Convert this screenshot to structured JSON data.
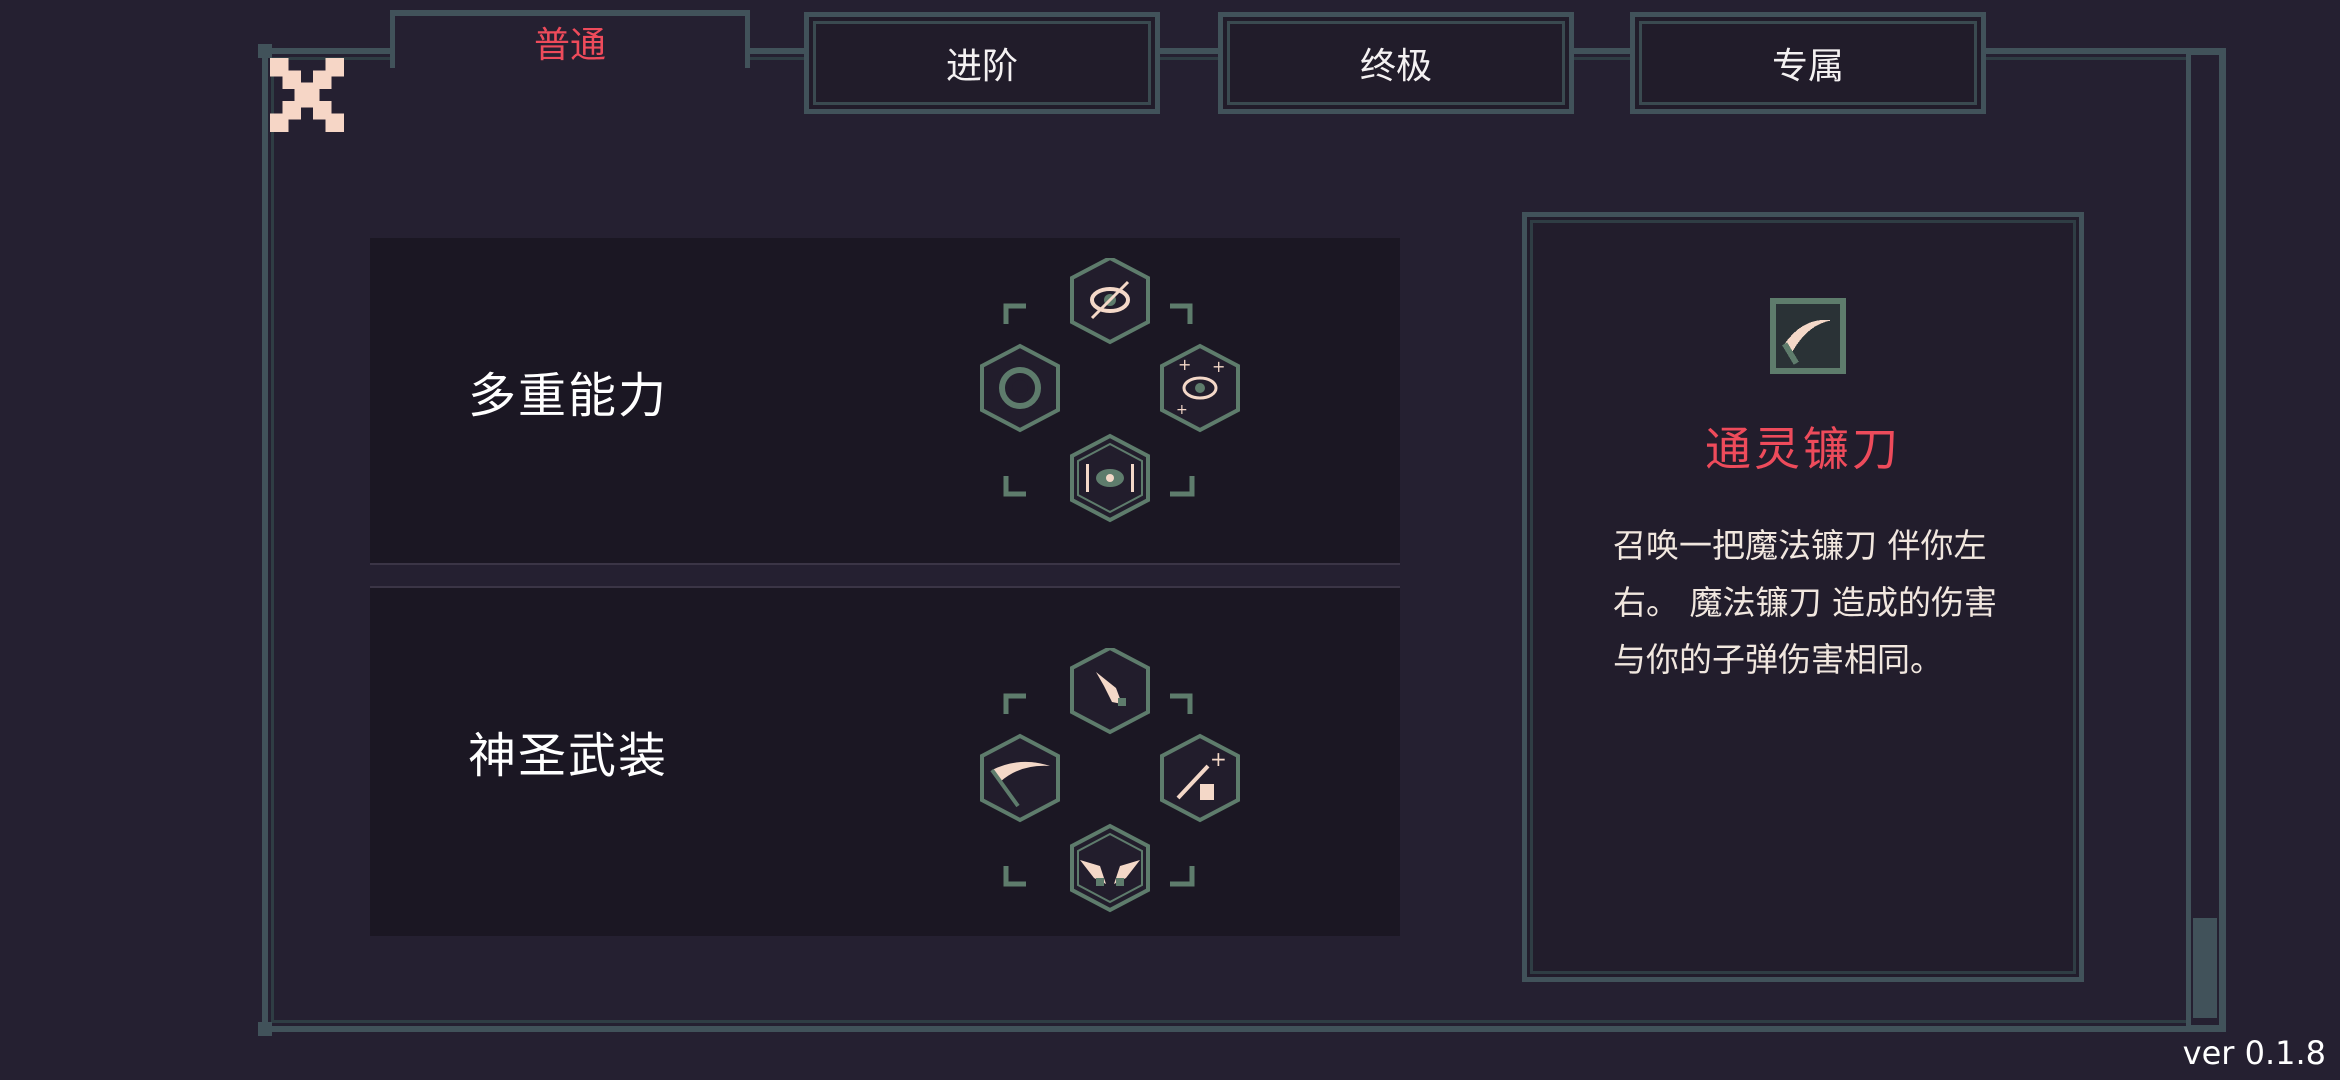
{
  "tabs": [
    {
      "label": "普通",
      "active": true
    },
    {
      "label": "进阶",
      "active": false
    },
    {
      "label": "终极",
      "active": false
    },
    {
      "label": "专属",
      "active": false
    }
  ],
  "skill_groups": [
    {
      "label": "多重能力"
    },
    {
      "label": "神圣武装"
    }
  ],
  "info": {
    "title": "通灵镰刀",
    "description": "召唤一把魔法镰刀 伴你左右。 魔法镰刀 造成的伤害与你的子弹伤害相同。",
    "icon": "scythe-icon"
  },
  "version": "ver 0.1.8",
  "colors": {
    "frame": "#41525a",
    "accent_red": "#ee4b5b",
    "background": "#252031",
    "panel": "#1b1723",
    "icon_green": "#5e7c6c",
    "icon_cream": "#f4d8c8"
  }
}
